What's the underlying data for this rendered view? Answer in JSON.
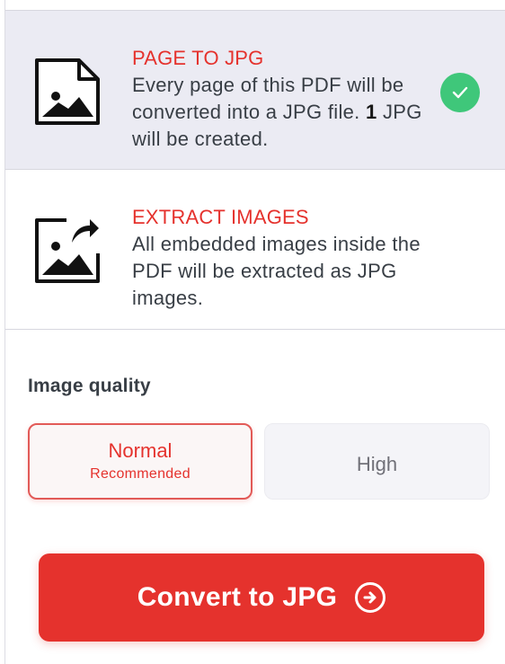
{
  "options": [
    {
      "title": "PAGE TO JPG",
      "desc_before": "Every page of this PDF will be converted into a JPG file. ",
      "desc_bold": "1",
      "desc_after": " JPG will be created.",
      "icon": "page-image-icon",
      "selected": true
    },
    {
      "title": "EXTRACT IMAGES",
      "desc": "All embedded images inside the PDF will be extracted as JPG images.",
      "icon": "extract-image-icon",
      "selected": false
    }
  ],
  "selected_icon": "check-icon",
  "image_quality": {
    "label": "Image quality",
    "normal": {
      "label": "Normal",
      "sublabel": "Recommended",
      "selected": true
    },
    "high": {
      "label": "High",
      "selected": false
    }
  },
  "convert_button": {
    "label": "Convert to JPG",
    "icon": "arrow-right-circle-icon"
  },
  "colors": {
    "accent": "#e5322d",
    "success": "#3fc77a",
    "selected_bg": "#ebebf3"
  }
}
